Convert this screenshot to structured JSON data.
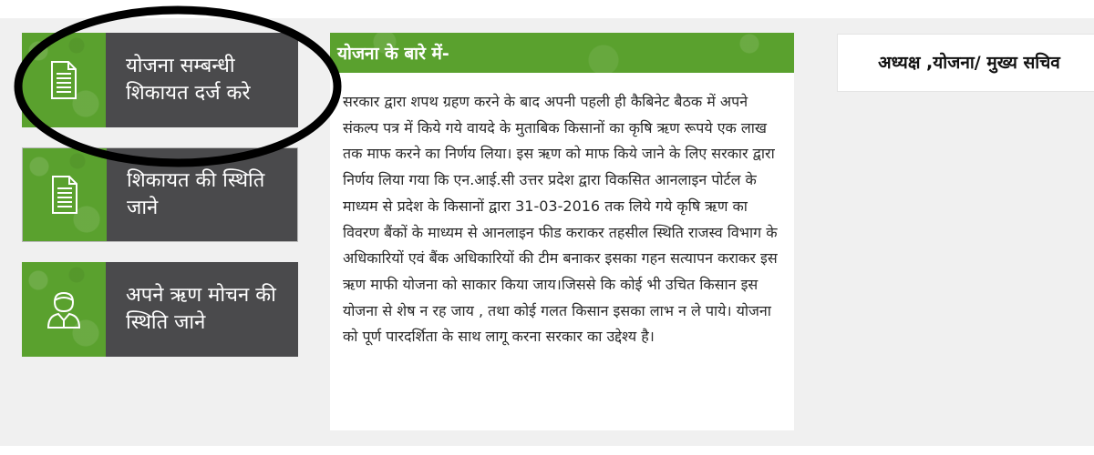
{
  "tiles": [
    {
      "label": "योजना सम्बन्धी शिकायत दर्ज करे",
      "icon": "document-icon"
    },
    {
      "label": "शिकायत की स्थिति जाने",
      "icon": "document-icon"
    },
    {
      "label": "अपने ऋण मोचन की स्थिति जाने",
      "icon": "user-icon"
    }
  ],
  "about": {
    "title": "योजना के बारे में-",
    "body": "सरकार द्वारा शपथ ग्रहण करने के बाद अपनी पहली ही कैबिनेट बैठक में अपने संकल्प पत्र में किये गये वायदे के मुताबिक किसानों का कृषि ऋण रूपये एक लाख तक माफ करने का निर्णय लिया। इस ऋण को माफ किये जाने के लिए सरकार द्वारा निर्णय लिया गया कि एन.आई.सी उत्तर प्रदेश द्वारा विकसित आनलाइन पोर्टल के माध्यम से प्रदेश के किसानों द्वारा 31-03-2016 तक लिये गये कृषि ऋण का विवरण बैंकों के माध्यम से आनलाइन फीड कराकर तहसील स्थिति राजस्व विभाग के अधिकारियों एवं बैंक अधिकारियों की टीम बनाकर इसका गहन सत्यापन कराकर इस ऋण माफी योजना को साकार किया जाय।जिससे कि कोई भी उचित किसान इस योजना से शेष न रह जाय , तथा कोई गलत किसान इसका लाभ न ले पाये। योजना को पूर्ण पारदर्शिता के साथ लागू करना सरकार का उद्देश्य है।"
  },
  "sidebar": {
    "title": "अध्यक्ष ,योजना/ मुख्य सचिव"
  },
  "colors": {
    "green": "#5aa12e",
    "dark_panel": "#4a4a4c",
    "page_bg": "#f0f0f0"
  }
}
